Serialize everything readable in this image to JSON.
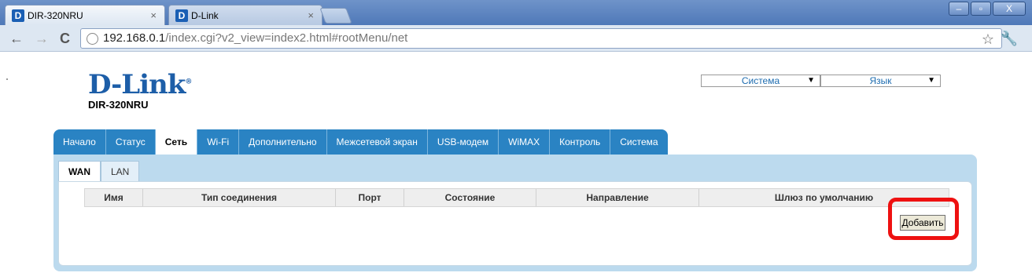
{
  "browser": {
    "tabs": [
      {
        "title": "DIR-320NRU",
        "favicon": "D"
      },
      {
        "title": "D-Link",
        "favicon": "D"
      }
    ],
    "close_glyph": "×",
    "window_buttons": {
      "minimize": "–",
      "maximize": "▫",
      "close": "X"
    },
    "url_host": "192.168.0.1",
    "url_path": "/index.cgi?v2_view=index2.html#rootMenu/net"
  },
  "header": {
    "logo": "D-Link",
    "logo_mark": "®",
    "model": "DIR-320NRU",
    "system_select": "Система",
    "language_select": "Язык"
  },
  "menu": {
    "items": [
      "Начало",
      "Статус",
      "Сеть",
      "Wi-Fi",
      "Дополнительно",
      "Межсетевой экран",
      "USB-модем",
      "WiMAX",
      "Контроль",
      "Система"
    ],
    "active": "Сеть"
  },
  "subtabs": {
    "items": [
      "WAN",
      "LAN"
    ],
    "active": "WAN"
  },
  "table": {
    "columns": [
      "Имя",
      "Тип соединения",
      "Порт",
      "Состояние",
      "Направление",
      "Шлюз по умолчанию"
    ]
  },
  "actions": {
    "add_label": "Добавить"
  },
  "colors": {
    "menu": "#2a83c3",
    "panel": "#bcdaee",
    "highlight": "#ee1111",
    "logo": "#1d5ea8"
  },
  "icons": [
    "back-icon",
    "forward-icon",
    "reload-icon",
    "globe-icon",
    "star-icon",
    "wrench-icon",
    "dropdown-arrow-icon"
  ]
}
